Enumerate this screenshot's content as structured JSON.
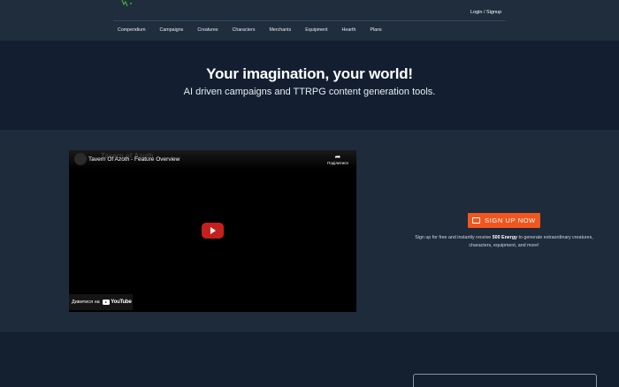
{
  "header": {
    "login_label": "Login / Signup",
    "nav": [
      "Compendium",
      "Campaigns",
      "Creatures",
      "Characters",
      "Merchants",
      "Equipment",
      "Hearth",
      "Plans"
    ]
  },
  "hero": {
    "title": "Your imagination, your world!",
    "subtitle": "AI driven campaigns and TTRPG content generation tools."
  },
  "video": {
    "title": "Tavern Of Azoth - Feature Overview",
    "watermark": "Tavern of Azoth",
    "share_label": "Поділитися",
    "watch_on_label": "Дивитися на",
    "youtube_label": "YouTube",
    "share_icon": "share-arrow-icon",
    "play_icon": "play-icon"
  },
  "signup": {
    "button_label": "SIGN UP NOW",
    "desc_before": "Sign up for free and instantly receive ",
    "desc_highlight": "500 Energy",
    "desc_after": " to generate extraordinary creatures, characters, equipment, and more!",
    "accent": "#f0561e"
  },
  "colors": {
    "header_bg": "#1f2d3d",
    "hero_bg": "#131f30",
    "feature_bg": "#1d2b3b",
    "bottom_bg": "#141f2f"
  }
}
